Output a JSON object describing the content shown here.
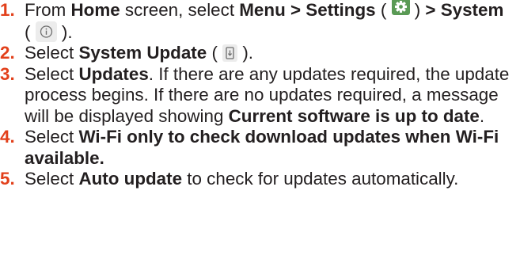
{
  "colors": {
    "accent": "#e2401b",
    "text": "#231f20",
    "icon_green": "#5a9a55"
  },
  "icons": {
    "settings": "gear-icon",
    "system": "info-icon",
    "system_update": "phone-download-icon"
  },
  "steps": [
    {
      "num": "1.",
      "t1": "From ",
      "b1": "Home",
      "t2": " screen, select ",
      "b2": "Menu > Settings",
      "t3": " ( ",
      "t4": " ) ",
      "b3": "> System",
      "t5": " ( ",
      "t6": " )."
    },
    {
      "num": "2.",
      "t1": "Select ",
      "b1": "System Update",
      "t2": " ( ",
      "t3": " )."
    },
    {
      "num": "3.",
      "t1": "Select ",
      "b1": "Updates",
      "t2": ". If there are any updates required, the update process begins. If there are no updates required,  a message will be displayed showing ",
      "b2": "Current software is up to date",
      "t3": "."
    },
    {
      "num": "4.",
      "t1": "Select ",
      "b1": "Wi-Fi only to check download updates when Wi-Fi available."
    },
    {
      "num": "5.",
      "t1": "Select ",
      "b1": "Auto update",
      "t2": " to check for updates automatically."
    }
  ]
}
